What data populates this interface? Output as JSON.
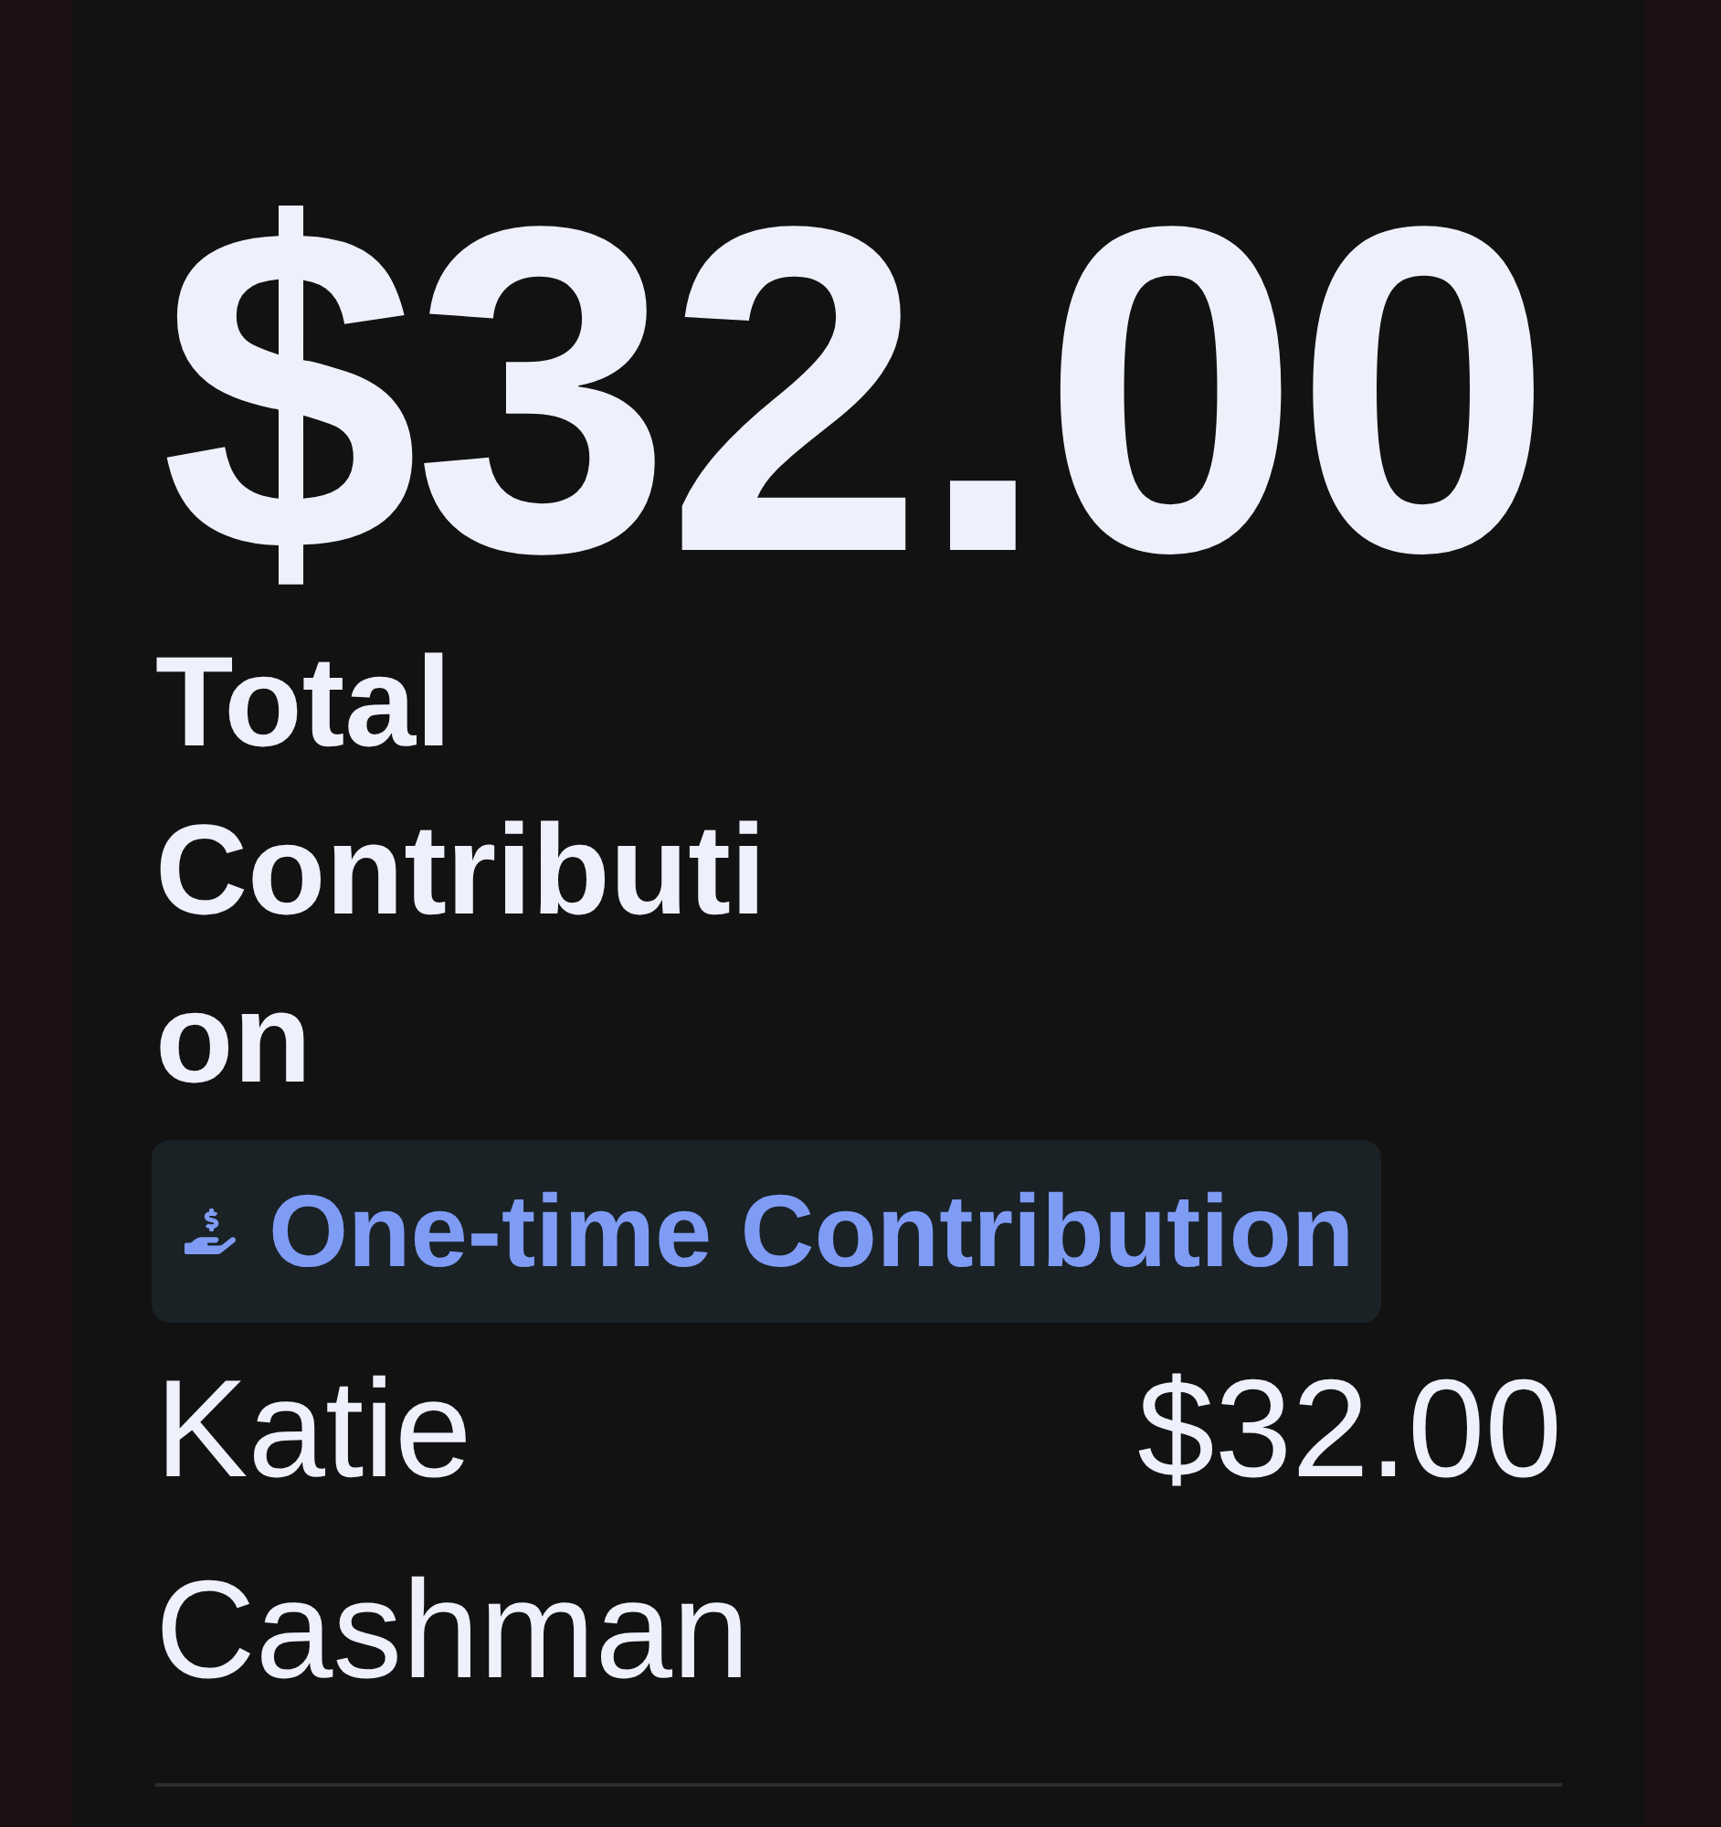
{
  "total": {
    "amount": "$32.00",
    "label": "Total Contribution"
  },
  "badge": {
    "label": "One-time Contribution"
  },
  "contributors": [
    {
      "name": "Katie Cashman",
      "amount": "$32.00"
    }
  ]
}
